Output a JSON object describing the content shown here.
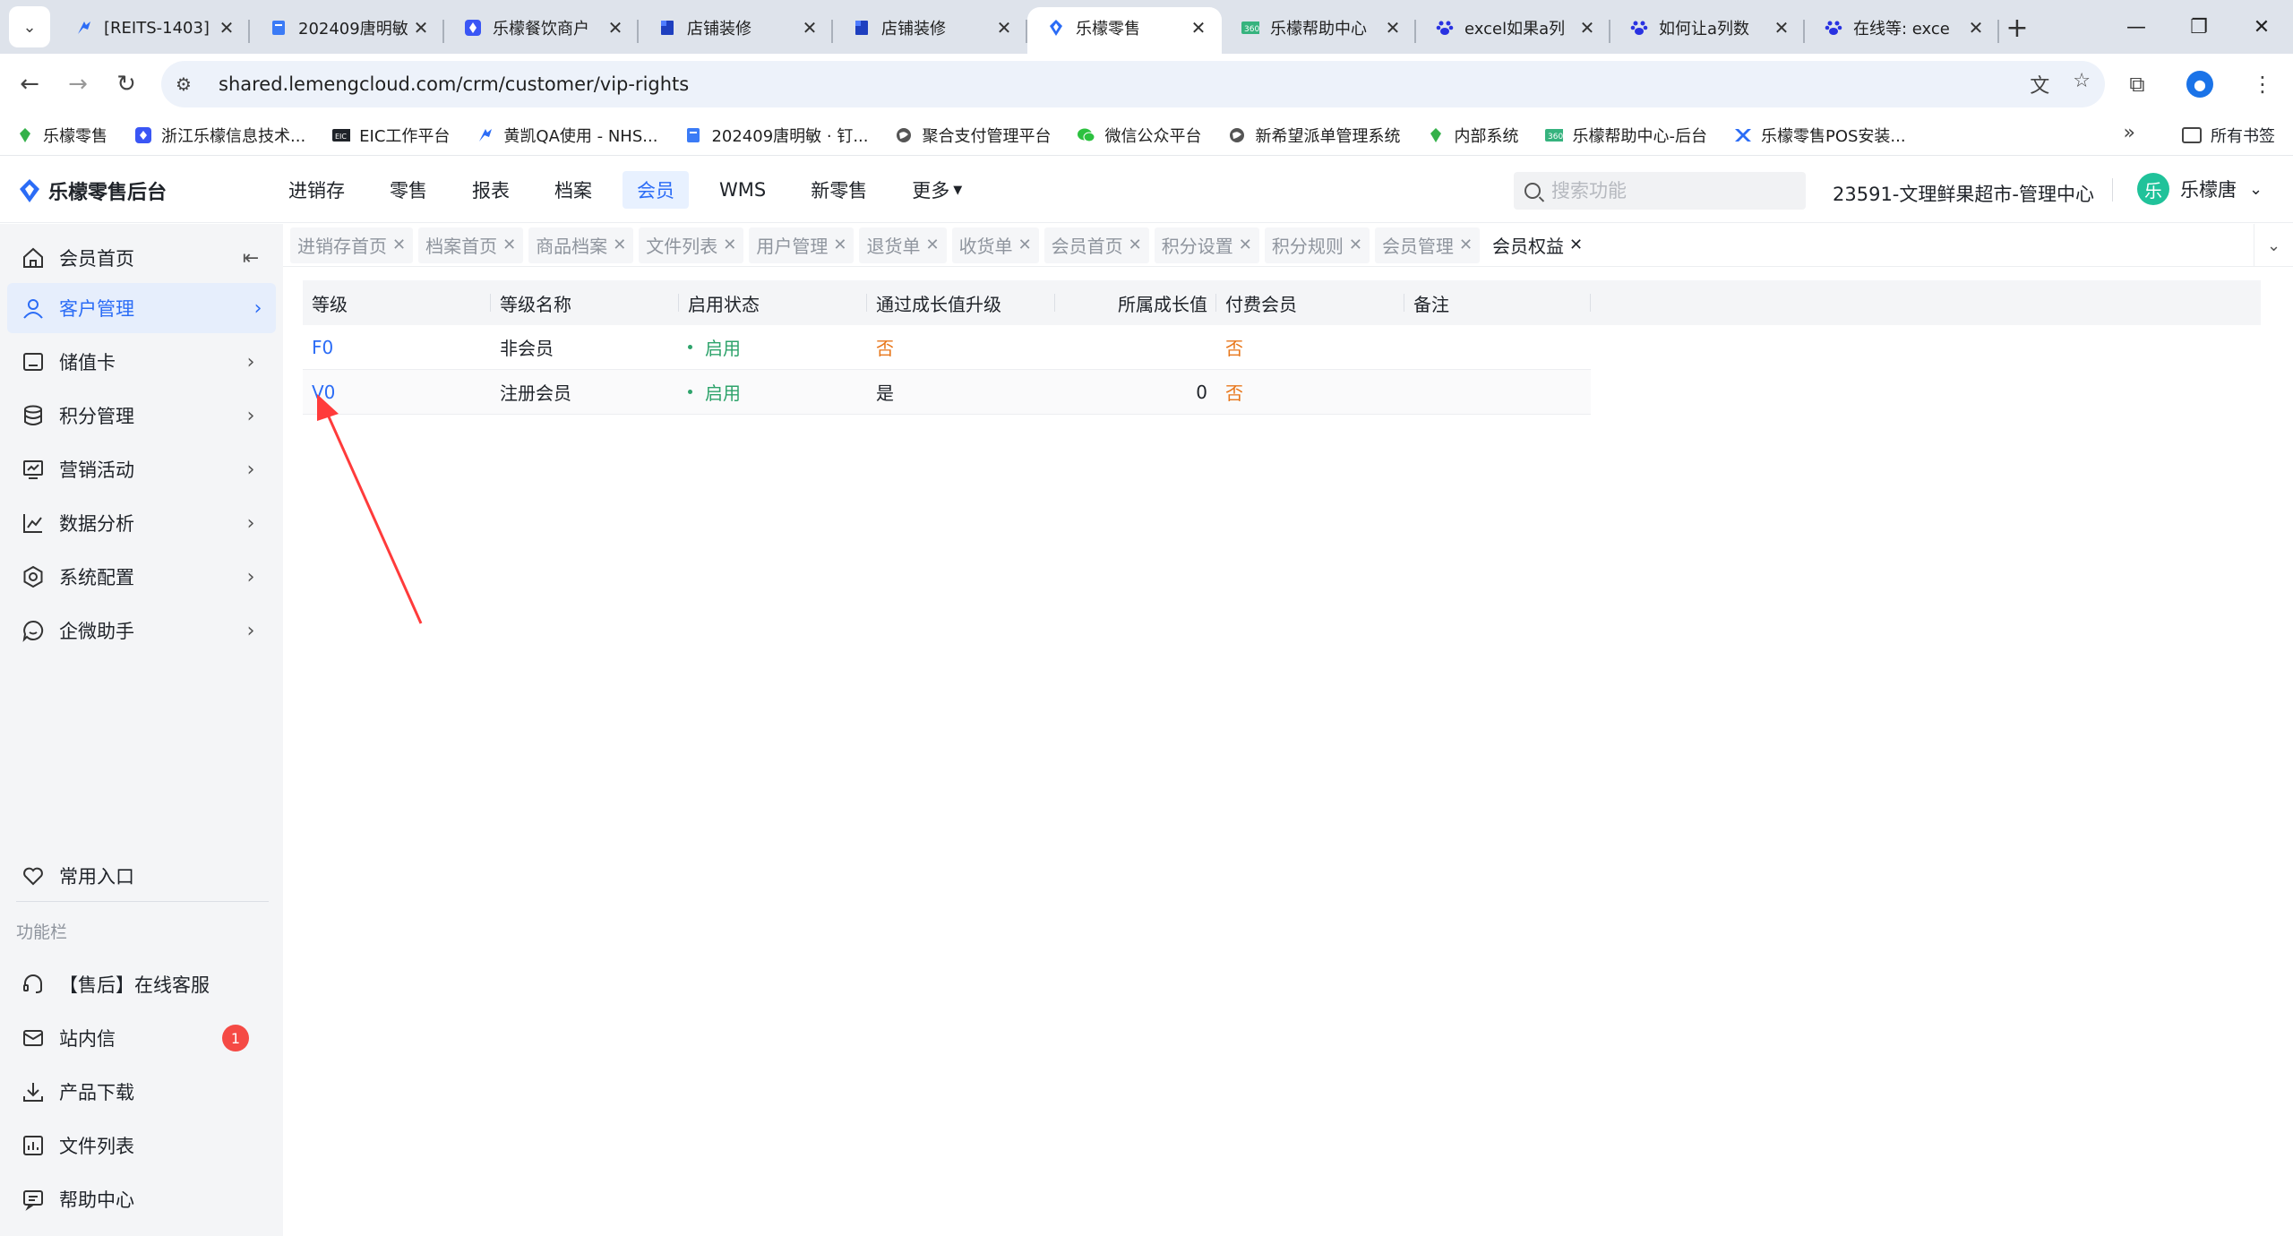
{
  "browser": {
    "tabs": [
      {
        "title": "[REITS-1403]",
        "icon": "jira-icon",
        "active": false
      },
      {
        "title": "202409唐明敏",
        "icon": "doc-icon",
        "active": false
      },
      {
        "title": "乐檬餐饮商户",
        "icon": "lemeng-icon",
        "active": false
      },
      {
        "title": "店铺装修",
        "icon": "doc-blue-icon",
        "active": false
      },
      {
        "title": "店铺装修",
        "icon": "doc-blue-icon",
        "active": false
      },
      {
        "title": "乐檬零售",
        "icon": "lemeng-icon",
        "active": true
      },
      {
        "title": "乐檬帮助中心",
        "icon": "help-center-icon",
        "active": false
      },
      {
        "title": "excel如果a列",
        "icon": "baidu-icon",
        "active": false
      },
      {
        "title": "如何让a列数",
        "icon": "baidu-icon",
        "active": false
      },
      {
        "title": "在线等: exce",
        "icon": "baidu-icon",
        "active": false
      }
    ],
    "url": "shared.lemengcloud.com/crm/customer/vip-rights",
    "bookmarks": [
      {
        "label": "乐檬零售",
        "icon": "lemeng-green-icon"
      },
      {
        "label": "浙江乐檬信息技术...",
        "icon": "lemeng-icon"
      },
      {
        "label": "EIC工作平台",
        "icon": "eic-icon"
      },
      {
        "label": "黄凯QA使用 - NHS...",
        "icon": "jira-icon"
      },
      {
        "label": "202409唐明敏 · 钉...",
        "icon": "doc-icon"
      },
      {
        "label": "聚合支付管理平台",
        "icon": "globe-icon"
      },
      {
        "label": "微信公众平台",
        "icon": "wechat-icon"
      },
      {
        "label": "新希望派单管理系统",
        "icon": "globe-icon"
      },
      {
        "label": "内部系统",
        "icon": "lemeng-green-icon"
      },
      {
        "label": "乐檬帮助中心-后台",
        "icon": "help-center-icon"
      },
      {
        "label": "乐檬零售POS安装...",
        "icon": "pos-icon"
      }
    ],
    "all_bookmarks": "所有书签"
  },
  "app": {
    "logo": "乐檬零售后台",
    "nav": [
      {
        "label": "进销存",
        "active": false
      },
      {
        "label": "零售",
        "active": false
      },
      {
        "label": "报表",
        "active": false
      },
      {
        "label": "档案",
        "active": false
      },
      {
        "label": "会员",
        "active": true
      },
      {
        "label": "WMS",
        "active": false
      },
      {
        "label": "新零售",
        "active": false
      },
      {
        "label": "更多",
        "active": false
      }
    ],
    "search_placeholder": "搜索功能",
    "org": "23591-文理鲜果超市-管理中心",
    "avatar_char": "乐",
    "user": "乐檬唐"
  },
  "sidebar": {
    "items": [
      {
        "label": "会员首页",
        "icon": "home-icon"
      },
      {
        "label": "客户管理",
        "icon": "user-icon"
      },
      {
        "label": "储值卡",
        "icon": "card-icon"
      },
      {
        "label": "积分管理",
        "icon": "database-icon"
      },
      {
        "label": "营销活动",
        "icon": "monitor-icon"
      },
      {
        "label": "数据分析",
        "icon": "chart-line-icon"
      },
      {
        "label": "系统配置",
        "icon": "settings-icon"
      },
      {
        "label": "企微助手",
        "icon": "chat-icon"
      }
    ],
    "common_entry": "常用入口",
    "group_title": "功能栏",
    "func_items": [
      {
        "label": "【售后】在线客服",
        "icon": "headset-icon"
      },
      {
        "label": "站内信",
        "icon": "mail-icon",
        "badge": "1"
      },
      {
        "label": "产品下载",
        "icon": "download-icon"
      },
      {
        "label": "文件列表",
        "icon": "file-list-icon"
      },
      {
        "label": "帮助中心",
        "icon": "help-icon"
      }
    ]
  },
  "page_tabs": [
    {
      "label": "进销存首页",
      "active": false
    },
    {
      "label": "档案首页",
      "active": false
    },
    {
      "label": "商品档案",
      "active": false
    },
    {
      "label": "文件列表",
      "active": false
    },
    {
      "label": "用户管理",
      "active": false
    },
    {
      "label": "退货单",
      "active": false
    },
    {
      "label": "收货单",
      "active": false
    },
    {
      "label": "会员首页",
      "active": false
    },
    {
      "label": "积分设置",
      "active": false
    },
    {
      "label": "积分规则",
      "active": false
    },
    {
      "label": "会员管理",
      "active": false
    },
    {
      "label": "会员权益",
      "active": true
    }
  ],
  "table": {
    "columns": [
      "等级",
      "等级名称",
      "启用状态",
      "通过成长值升级",
      "所属成长值",
      "付费会员",
      "备注"
    ],
    "rows": [
      {
        "level": "F0",
        "name": "非会员",
        "status": "启用",
        "upgrade": "否",
        "growth": "",
        "paid": "否",
        "note": ""
      },
      {
        "level": "V0",
        "name": "注册会员",
        "status": "启用",
        "upgrade": "是",
        "growth": "0",
        "paid": "否",
        "note": ""
      }
    ]
  },
  "colors": {
    "accent": "#2b6cf6",
    "success": "#2ea36b",
    "warning": "#e8771c",
    "annotation": "#ff3b3b"
  }
}
